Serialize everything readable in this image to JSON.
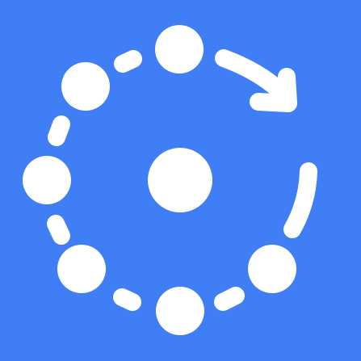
{
  "icon": {
    "name": "circular-dots-rotation-icon",
    "background_color": "#3f7ef5",
    "foreground_color": "#ffffff"
  }
}
